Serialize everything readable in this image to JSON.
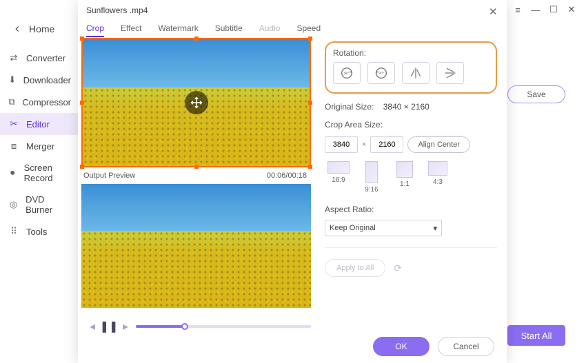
{
  "main_window": {
    "back_label": "Home",
    "nav": [
      {
        "label": "Converter",
        "icon": "converter-icon"
      },
      {
        "label": "Downloader",
        "icon": "downloader-icon"
      },
      {
        "label": "Compressor",
        "icon": "compressor-icon"
      },
      {
        "label": "Editor",
        "icon": "editor-icon"
      },
      {
        "label": "Merger",
        "icon": "merger-icon"
      },
      {
        "label": "Screen Record",
        "icon": "record-icon"
      },
      {
        "label": "DVD Burner",
        "icon": "dvd-icon"
      },
      {
        "label": "Tools",
        "icon": "tools-icon"
      }
    ],
    "save_label": "Save",
    "start_all_label": "Start All"
  },
  "editor_window": {
    "title": "Sunflowers .mp4",
    "tabs": [
      "Crop",
      "Effect",
      "Watermark",
      "Subtitle",
      "Audio",
      "Speed"
    ],
    "active_tab": "Crop",
    "disabled_tabs": [
      "Audio"
    ],
    "output_preview_label": "Output Preview",
    "time_display": "00:06/00:18",
    "ok_label": "OK",
    "cancel_label": "Cancel"
  },
  "crop_settings": {
    "rotation_label": "Rotation:",
    "rotation_buttons": [
      "90°",
      "90°",
      "flip-h",
      "flip-v"
    ],
    "original_size_label": "Original Size:",
    "original_size_value": "3840 × 2160",
    "crop_area_label": "Crop Area Size:",
    "crop_width": "3840",
    "crop_height": "2160",
    "align_center_label": "Align Center",
    "ratios": [
      "16:9",
      "9:16",
      "1:1",
      "4:3"
    ],
    "aspect_ratio_label": "Aspect Ratio:",
    "aspect_ratio_value": "Keep Original",
    "apply_all_label": "Apply to All"
  }
}
